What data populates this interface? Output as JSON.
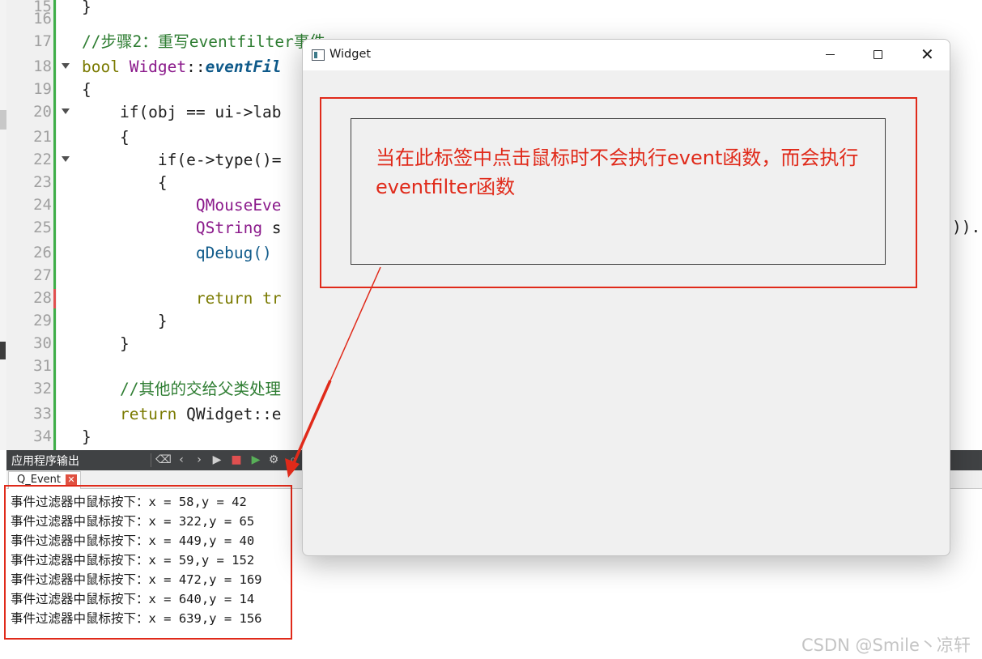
{
  "editor": {
    "lines": [
      {
        "num": "15",
        "code": "}",
        "fold": false
      },
      {
        "num": "16",
        "code": "",
        "fold": false
      },
      {
        "num": "17",
        "code": "//步骤2：重写eventfilter事件",
        "fold": false
      },
      {
        "num": "18",
        "kw": "bool ",
        "cls": "Widget",
        "op": "::",
        "fn": "eventFil",
        "fold": true
      },
      {
        "num": "19",
        "code": "{",
        "fold": false
      },
      {
        "num": "20",
        "code": "    if(obj == ui->lab",
        "fold": true
      },
      {
        "num": "21",
        "code": "    {",
        "fold": false
      },
      {
        "num": "22",
        "code": "        if(e->type()=",
        "fold": true
      },
      {
        "num": "23",
        "code": "        {",
        "fold": false
      },
      {
        "num": "24",
        "code": "            QMouseEve",
        "fold": false
      },
      {
        "num": "25",
        "ty": "            QString",
        "code": " s",
        "fold": false
      },
      {
        "num": "26",
        "code": "            qDebug()",
        "fold": false
      },
      {
        "num": "27",
        "code": "",
        "fold": false
      },
      {
        "num": "28",
        "kw": "            return",
        "code": " tr",
        "fold": false
      },
      {
        "num": "29",
        "code": "        }",
        "fold": false
      },
      {
        "num": "30",
        "code": "    }",
        "fold": false
      },
      {
        "num": "31",
        "code": "",
        "fold": false
      },
      {
        "num": "32",
        "code": "    //其他的交给父类处理",
        "fold": false
      },
      {
        "num": "33",
        "kw": "    return",
        "code": " QWidget::e",
        "fold": false
      },
      {
        "num": "34",
        "code": "}",
        "fold": false
      }
    ],
    "line25_tail": "))."
  },
  "output_pane": {
    "title": "应用程序输出",
    "tab_label": "Q_Event",
    "lines": [
      "事件过滤器中鼠标按下：x = 58,y = 42",
      "事件过滤器中鼠标按下：x = 322,y = 65",
      "事件过滤器中鼠标按下：x = 449,y = 40",
      "事件过滤器中鼠标按下：x = 59,y = 152",
      "事件过滤器中鼠标按下：x = 472,y = 169",
      "事件过滤器中鼠标按下：x = 640,y = 14",
      "事件过滤器中鼠标按下：x = 639,y = 156"
    ]
  },
  "widget_window": {
    "title": "Widget",
    "label_text": "当在此标签中点击鼠标时不会执行event函数，而会执行eventfilter函数"
  },
  "colors": {
    "accent_red": "#e02a1a",
    "keyword": "#7a7a00",
    "type": "#8b1a8b",
    "comment": "#2e7d32",
    "function": "#0f5a8a",
    "gutter_green": "#3fae49"
  },
  "watermark": "CSDN @Smile丶凉轩"
}
